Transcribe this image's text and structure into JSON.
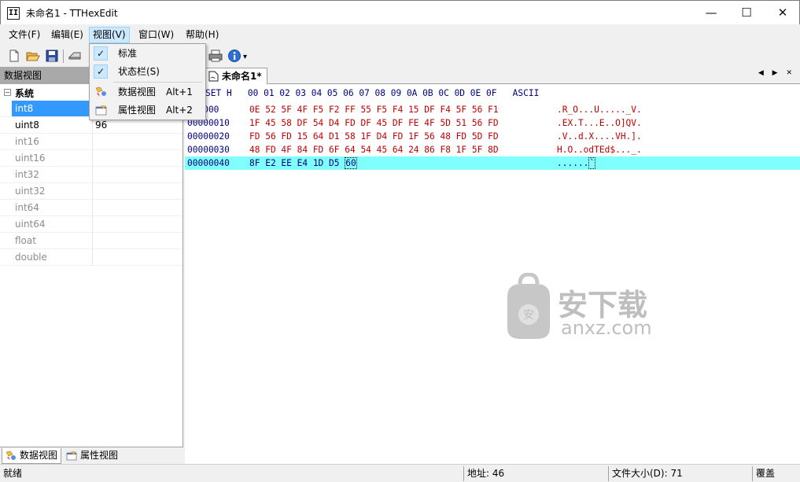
{
  "window": {
    "app_icon_glyph": "II",
    "title": "未命名1 - TTHexEdit",
    "minimize_glyph": "—",
    "maximize_glyph": "☐",
    "close_glyph": "✕"
  },
  "menubar": {
    "file": "文件(F)",
    "edit": "编辑(E)",
    "view": "视图(V)",
    "window": "窗口(W)",
    "help": "帮助(H)"
  },
  "view_menu": {
    "items": [
      {
        "label": "标准",
        "checked": true
      },
      {
        "label": "状态栏(S)",
        "checked": true
      },
      {
        "label": "数据视图",
        "accelerator": "Alt+1"
      },
      {
        "label": "属性视图",
        "accelerator": "Alt+2"
      }
    ],
    "check_glyph": "✓"
  },
  "toolbar": {
    "icons": [
      "new-file-icon",
      "open-folder-icon",
      "save-disk-icon",
      "eraser-icon",
      "print-icon",
      "info-icon"
    ],
    "dropdown_glyph": "▾"
  },
  "data_view": {
    "title": "数据视图",
    "group": {
      "label": "系统",
      "toggle_glyph": "−"
    },
    "rows": [
      {
        "name": "int8",
        "value": "",
        "selected": true,
        "enabled": true
      },
      {
        "name": "uint8",
        "value": "96",
        "selected": false,
        "enabled": true
      },
      {
        "name": "int16",
        "value": "",
        "enabled": false
      },
      {
        "name": "uint16",
        "value": "",
        "enabled": false
      },
      {
        "name": "int32",
        "value": "",
        "enabled": false
      },
      {
        "name": "uint32",
        "value": "",
        "enabled": false
      },
      {
        "name": "int64",
        "value": "",
        "enabled": false
      },
      {
        "name": "uint64",
        "value": "",
        "enabled": false
      },
      {
        "name": "float",
        "value": "",
        "enabled": false
      },
      {
        "name": "double",
        "value": "",
        "enabled": false
      }
    ],
    "tabs": [
      "数据视图",
      "属性视图"
    ]
  },
  "editor": {
    "tab_label": "未命名1*",
    "nav_arrows": "◀ ▶ ✕",
    "header": "SET H   00 01 02 03 04 05 06 07 08 09 0A 0B 0C 0D 0E 0F   ASCII",
    "rows": [
      {
        "offset": "000000",
        "hex": "0E 52 5F 4F F5 F2 FF 55 F5 F4 15 DF F4 5F 56 F1",
        "ascii": ".R_O...U....._V."
      },
      {
        "offset": "00000010",
        "hex": "1F 45 58 DF 54 D4 FD DF 45 DF FE 4F 5D 51 56 FD",
        "ascii": ".EX.T...E..O]QV."
      },
      {
        "offset": "00000020",
        "hex": "FD 56 FD 15 64 D1 58 1F D4 FD 1F 56 48 FD 5D FD",
        "ascii": ".V..d.X....VH.]."
      },
      {
        "offset": "00000030",
        "hex": "48 FD 4F 84 FD 6F 64 54 45 64 24 86 F8 1F 5F 8D",
        "ascii": "H.O..odTEd$..._."
      },
      {
        "offset": "00000040",
        "hex": "8F E2 EE E4 1D D5 ",
        "hex_cursor": "60",
        "ascii": "......",
        "ascii_cursor": "`",
        "current": true
      }
    ]
  },
  "watermark": {
    "brand": "安下载",
    "domain": "anxz.com"
  },
  "statusbar": {
    "status": "就绪",
    "address": "地址: 46",
    "file_size": "文件大小(D): 71",
    "mode": "覆盖"
  }
}
